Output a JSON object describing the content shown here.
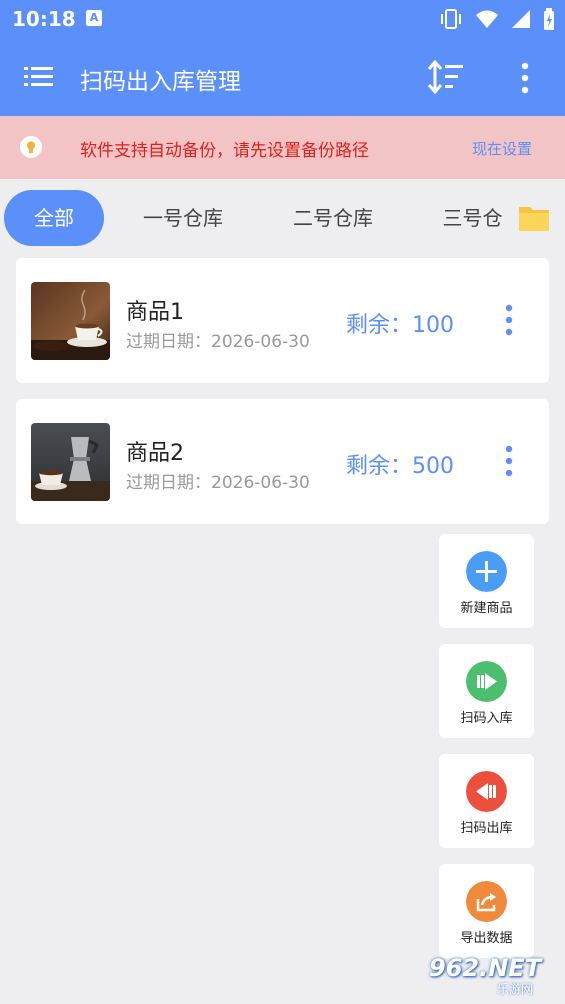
{
  "status_bar": {
    "time": "10:18",
    "app_badge": "A"
  },
  "app_bar": {
    "title": "扫码出入库管理"
  },
  "notice": {
    "text": "软件支持自动备份，请先设置备份路径",
    "action": "现在设置"
  },
  "tabs": [
    {
      "label": "全部",
      "active": true
    },
    {
      "label": "一号仓库",
      "active": false
    },
    {
      "label": "二号仓库",
      "active": false
    },
    {
      "label": "三号仓",
      "active": false
    }
  ],
  "products": [
    {
      "name": "商品1",
      "expiry": "过期日期：2026-06-30",
      "stock": "剩余：100"
    },
    {
      "name": "商品2",
      "expiry": "过期日期：2026-06-30",
      "stock": "剩余：500"
    }
  ],
  "actions": [
    {
      "label": "新建商品",
      "icon": "plus-icon",
      "color": "#4a9df7"
    },
    {
      "label": "扫码入库",
      "icon": "scan-in-icon",
      "color": "#4cbf6e"
    },
    {
      "label": "扫码出库",
      "icon": "scan-out-icon",
      "color": "#ec4f3c"
    },
    {
      "label": "导出数据",
      "icon": "export-icon",
      "color": "#f08a3a"
    }
  ],
  "watermark": {
    "text": "962.NET",
    "sub": "乐游网"
  },
  "colors": {
    "primary": "#5b8ff9",
    "notice_bg": "#f3c4c5",
    "notice_text": "#e0201e",
    "page_bg": "#eeeef0"
  }
}
